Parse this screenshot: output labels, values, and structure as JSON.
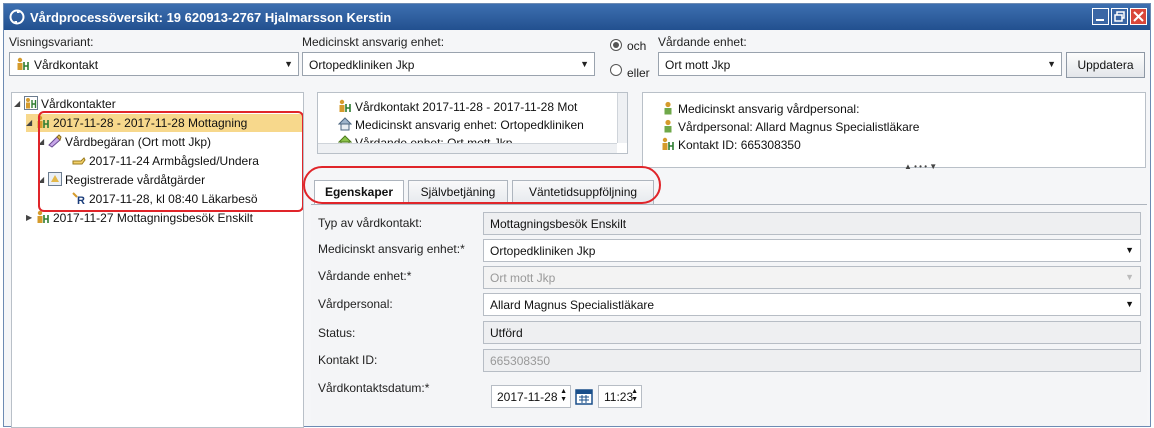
{
  "window": {
    "title": "Vårdprocessöversikt: 19 620913-2767 Hjalmarsson Kerstin"
  },
  "filters": {
    "visningsvariant_label": "Visningsvariant:",
    "visningsvariant_value": "Vårdkontakt",
    "med_enhet_label": "Medicinskt ansvarig enhet:",
    "med_enhet_value": "Ortopedkliniken Jkp",
    "radio_och": "och",
    "radio_eller": "eller",
    "vardande_label": "Vårdande enhet:",
    "vardande_value": "Ort mott Jkp",
    "update_button": "Uppdatera"
  },
  "tree": {
    "root": "Vårdkontakter",
    "items": [
      {
        "label": "2017-11-28  -  2017-11-28  Mottagning"
      },
      {
        "label": "Vårdbegäran (Ort mott Jkp)"
      },
      {
        "label": "2017-11-24  Armbågsled/Undera"
      },
      {
        "label": "Registrerade vårdåtgärder"
      },
      {
        "label": "2017-11-28, kl 08:40  Läkarbesö"
      },
      {
        "label": "2017-11-27  Mottagningsbesök Enskilt"
      }
    ]
  },
  "summary_left": {
    "lines": [
      "Vårdkontakt 2017-11-28  -  2017-11-28  Mot",
      "Medicinskt ansvarig enhet: Ortopedkliniken",
      "Vårdande enhet: Ort mott Jkp"
    ]
  },
  "summary_right": {
    "lines": [
      "Medicinskt ansvarig vårdpersonal:",
      "Vårdpersonal: Allard Magnus Specialistläkare",
      "Kontakt ID: 665308350"
    ]
  },
  "tabs": [
    "Egenskaper",
    "Självbetjäning",
    "Väntetidsuppföljning"
  ],
  "form": {
    "typ_label": "Typ av vårdkontakt:",
    "typ_value": "Mottagningsbesök Enskilt",
    "med_enhet_label": "Medicinskt ansvarig enhet:*",
    "med_enhet_value": "Ortopedkliniken Jkp",
    "vardande_label": "Vårdande enhet:*",
    "vardande_value": "Ort mott Jkp",
    "vardpersonal_label": "Vårdpersonal:",
    "vardpersonal_value": "Allard Magnus Specialistläkare",
    "status_label": "Status:",
    "status_value": "Utförd",
    "kontakt_label": "Kontakt ID:",
    "kontakt_value": "665308350",
    "datum_label": "Vårdkontaktsdatum:*",
    "datum_value": "2017-11-28",
    "time_value": "11:23"
  },
  "colors": {
    "titlebar": "#2d5c9e",
    "highlight": "#e0252a",
    "selected_row": "#f7d88c"
  }
}
